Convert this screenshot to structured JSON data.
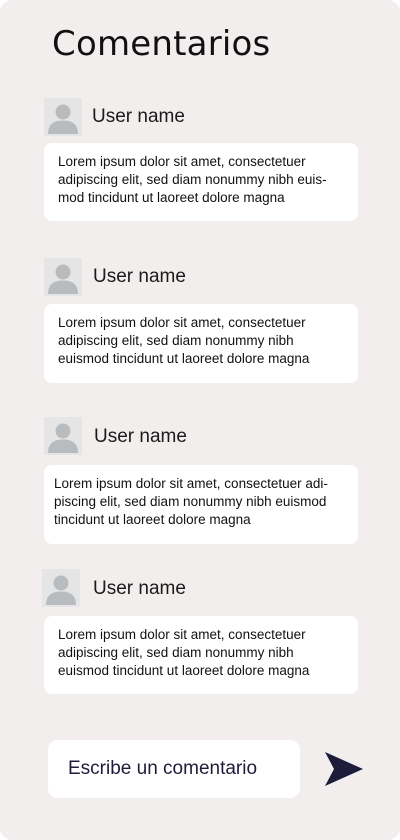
{
  "header": {
    "title": "Comentarios"
  },
  "comments": [
    {
      "user_name": "User name",
      "text": "Lorem ipsum dolor sit amet, consectetuer adipiscing elit, sed diam nonummy nibh euis-mod tincidunt ut laoreet dolore magna"
    },
    {
      "user_name": "User name",
      "text": "Lorem ipsum dolor sit amet, consectetuer adipiscing elit, sed diam nonummy nibh euismod tincidunt ut laoreet dolore magna"
    },
    {
      "user_name": "User name",
      "text": "Lorem ipsum dolor sit amet, consectetuer adi-piscing elit, sed diam nonummy nibh euismod tincidunt ut laoreet dolore magna"
    },
    {
      "user_name": "User name",
      "text": "Lorem ipsum dolor sit amet, consectetuer adipiscing elit, sed diam nonummy nibh euismod tincidunt ut laoreet dolore magna"
    }
  ],
  "composer": {
    "placeholder": "Escribe un comentario",
    "send_icon": "send-icon"
  },
  "colors": {
    "background": "#f3eeee",
    "card": "#ffffff",
    "avatar_bg": "#e5e5e5",
    "avatar_figure": "#b9bcbf",
    "accent": "#1d1d3b"
  }
}
